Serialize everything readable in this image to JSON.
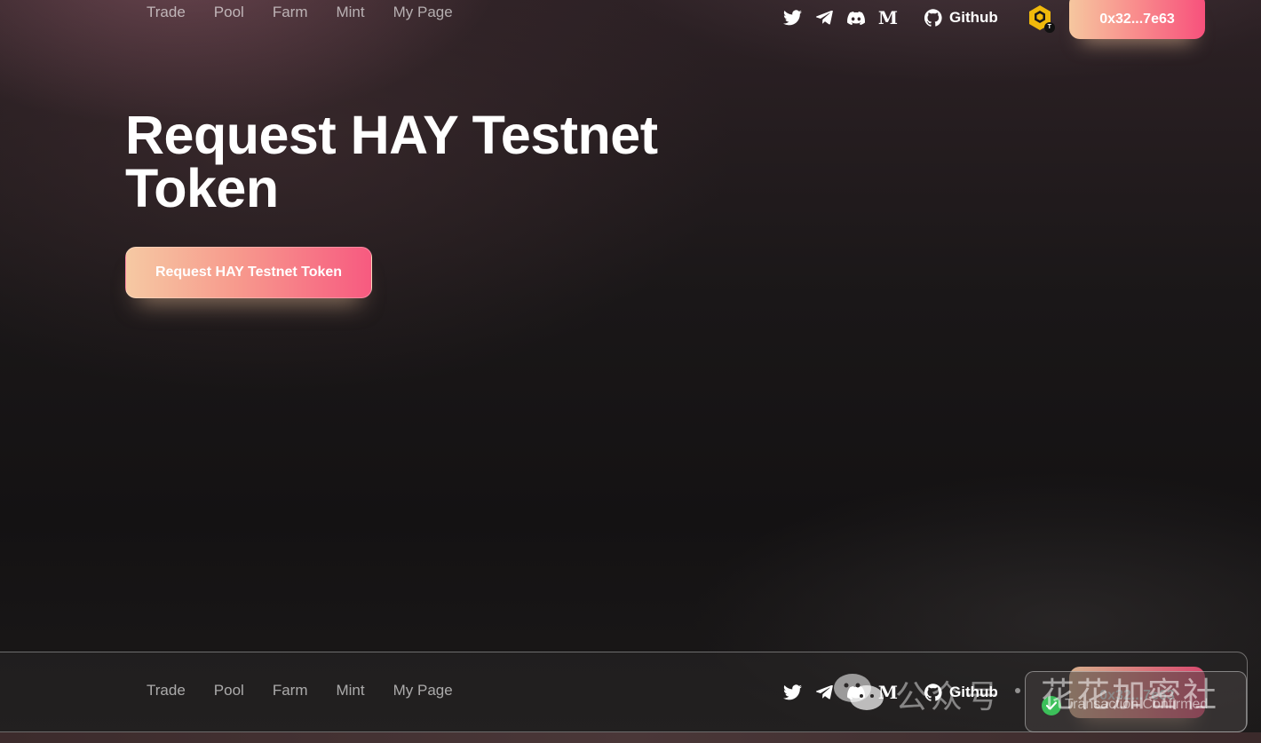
{
  "nav": {
    "links": [
      "Trade",
      "Pool",
      "Farm",
      "Mint",
      "My Page"
    ],
    "social_icons": [
      "twitter-icon",
      "telegram-icon",
      "discord-icon",
      "medium-icon"
    ],
    "medium_glyph": "M",
    "github_label": "Github",
    "network_icon": "bnb-chain-icon",
    "network_badge": "T",
    "wallet_address": "0x32...7e63"
  },
  "hero": {
    "title": "Request HAY Testnet Token",
    "button_label": "Request HAY Testnet Token"
  },
  "toast": {
    "icon": "check-circle-icon",
    "message": "Transaction Confirmed"
  },
  "watermark": {
    "icon": "wechat-icon",
    "label_left": "公众号",
    "label_right": "花花加密社"
  },
  "colors": {
    "accent_start": "#f6c79f",
    "accent_mid": "#f98b8c",
    "accent_end": "#f7517c",
    "success": "#3cc05a"
  }
}
